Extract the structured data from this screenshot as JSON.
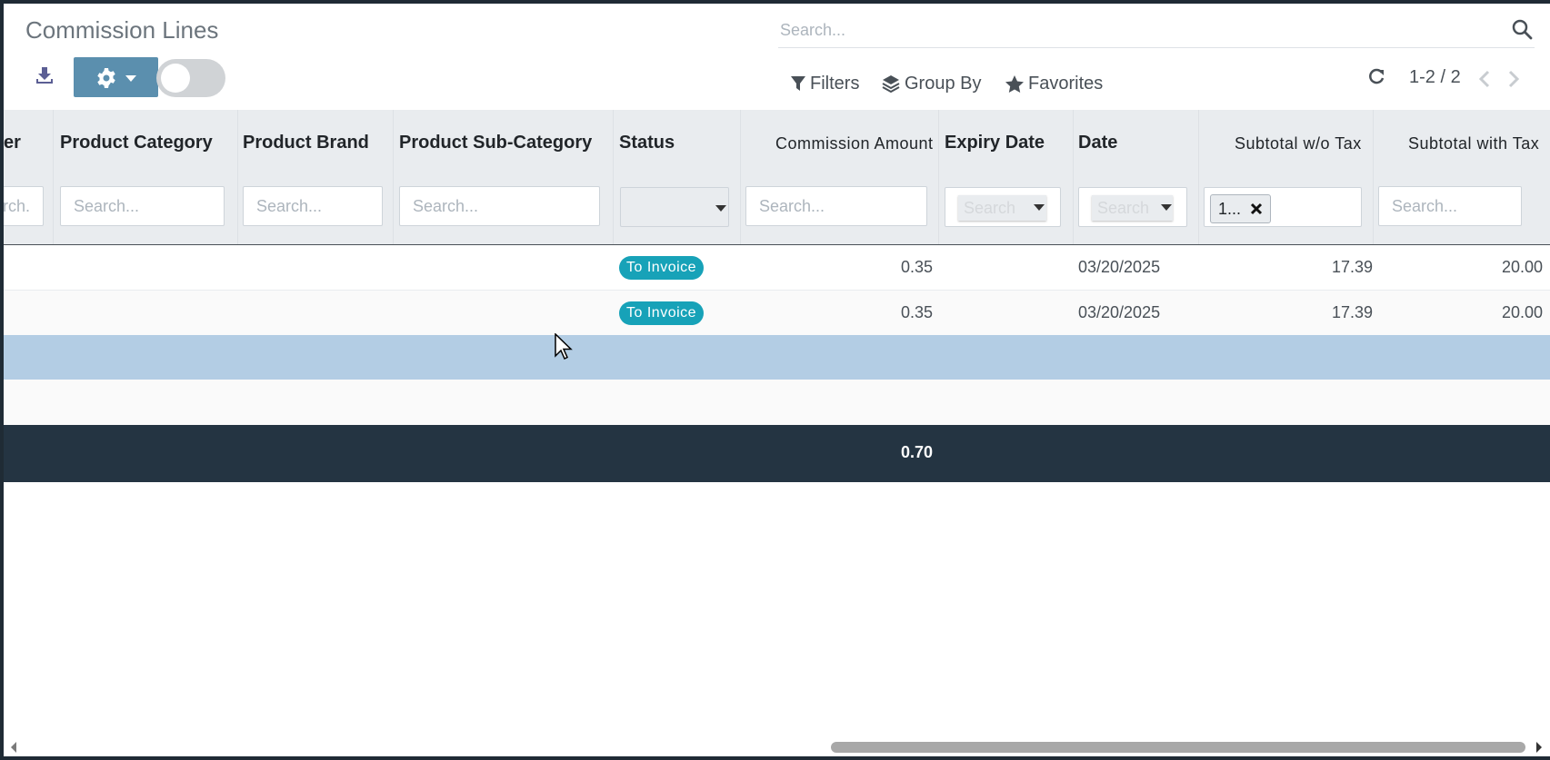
{
  "page": {
    "title": "Commission Lines"
  },
  "search": {
    "placeholder": "Search..."
  },
  "toolbar": {
    "download_icon": "download-icon",
    "settings_icon": "gear-icon"
  },
  "filters": {
    "filters_label": "Filters",
    "group_by_label": "Group By",
    "favorites_label": "Favorites"
  },
  "pager": {
    "range": "1-2 / 2"
  },
  "table": {
    "columns": {
      "partial": "er",
      "product_category": "Product Category",
      "product_brand": "Product Brand",
      "product_subcategory": "Product Sub-Category",
      "status": "Status",
      "commission_amount": "Commission Amount",
      "expiry_date": "Expiry Date",
      "date": "Date",
      "subtotal_wo_tax": "Subtotal w/o Tax",
      "subtotal_with_tax": "Subtotal with Tax"
    },
    "column_filters": {
      "partial_placeholder": "rch.",
      "search_placeholder": "Search...",
      "dropdown_search_label": "Search",
      "subtotal_tag": "1..."
    },
    "rows": [
      {
        "status": "To Invoice",
        "commission_amount": "0.35",
        "date": "03/20/2025",
        "subtotal_wo_tax": "17.39",
        "subtotal_with_tax": "20.00"
      },
      {
        "status": "To Invoice",
        "commission_amount": "0.35",
        "date": "03/20/2025",
        "subtotal_wo_tax": "17.39",
        "subtotal_with_tax": "20.00"
      }
    ],
    "footer": {
      "commission_total": "0.70"
    }
  },
  "colors": {
    "accent": "#5b8fae",
    "badge": "#17a2b8",
    "footer_bg": "#243442",
    "selected_row": "#b3cde4"
  }
}
